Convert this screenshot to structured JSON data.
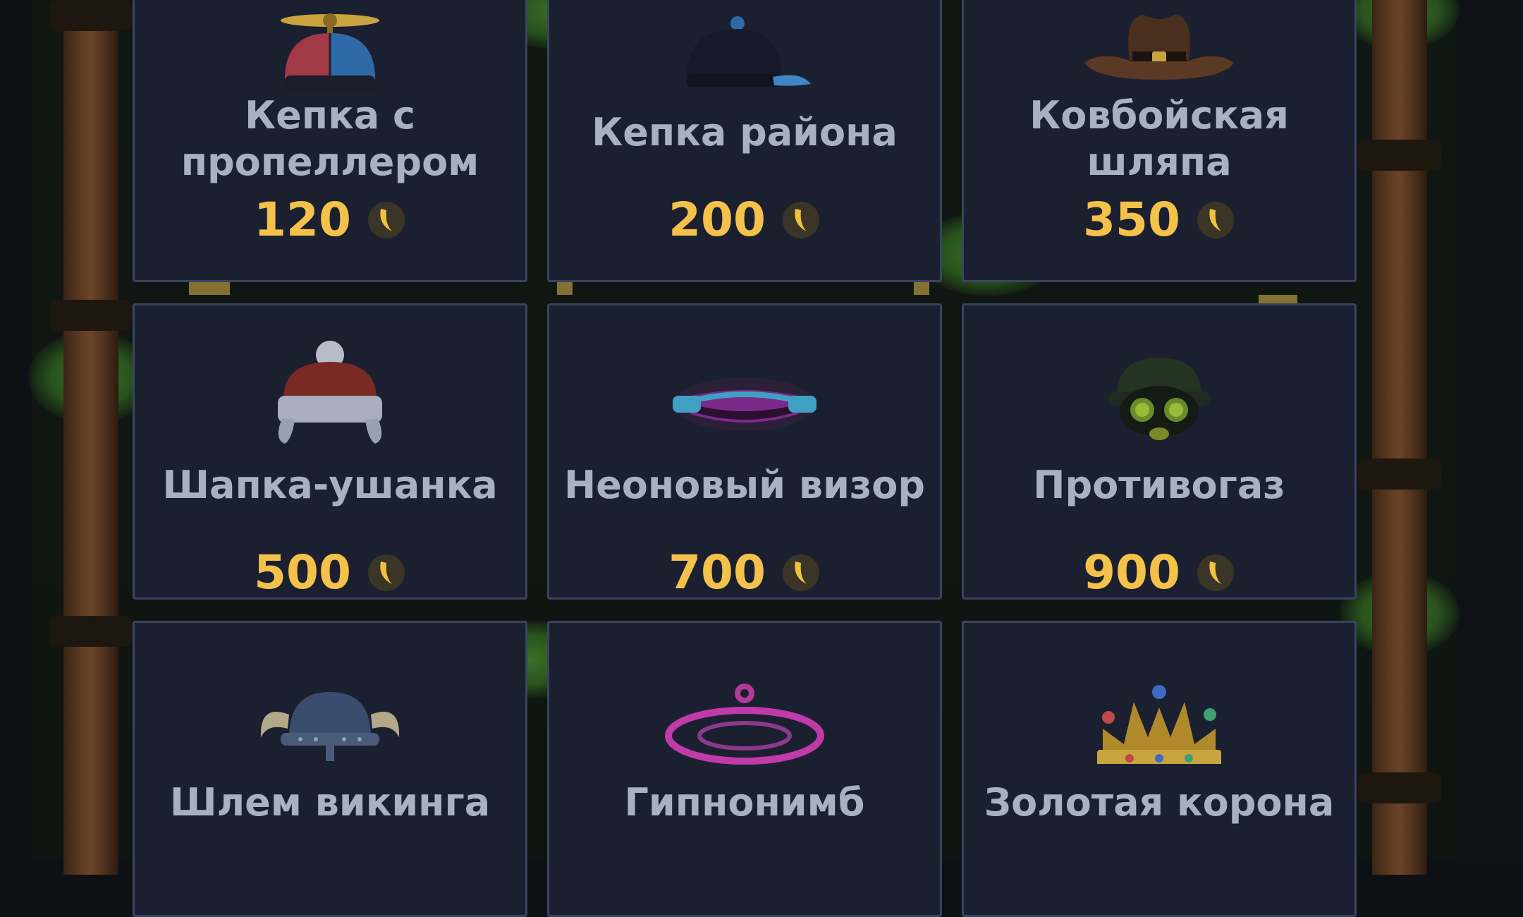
{
  "shop": {
    "items": [
      {
        "name": "Кепка с пропеллером",
        "price": "120",
        "icon": "propeller-cap-icon"
      },
      {
        "name": "Кепка района",
        "price": "200",
        "icon": "baseball-cap-icon"
      },
      {
        "name": "Ковбойская шляпа",
        "price": "350",
        "icon": "cowboy-hat-icon"
      },
      {
        "name": "Шапка-ушанка",
        "price": "500",
        "icon": "ushanka-hat-icon"
      },
      {
        "name": "Неоновый визор",
        "price": "700",
        "icon": "neon-visor-icon"
      },
      {
        "name": "Противогаз",
        "price": "900",
        "icon": "gas-mask-icon"
      },
      {
        "name": "Шлем викинга",
        "price": "",
        "icon": "viking-helmet-icon"
      },
      {
        "name": "Гипнонимб",
        "price": "",
        "icon": "hypno-halo-icon"
      },
      {
        "name": "Золотая корона",
        "price": "",
        "icon": "golden-crown-icon"
      }
    ],
    "currency_icon": "banana-coin-icon"
  },
  "colors": {
    "card_bg": "#1b2030",
    "card_border": "#3a4460",
    "name_text": "#a8b0c2",
    "price_text": "#f4c24a"
  }
}
